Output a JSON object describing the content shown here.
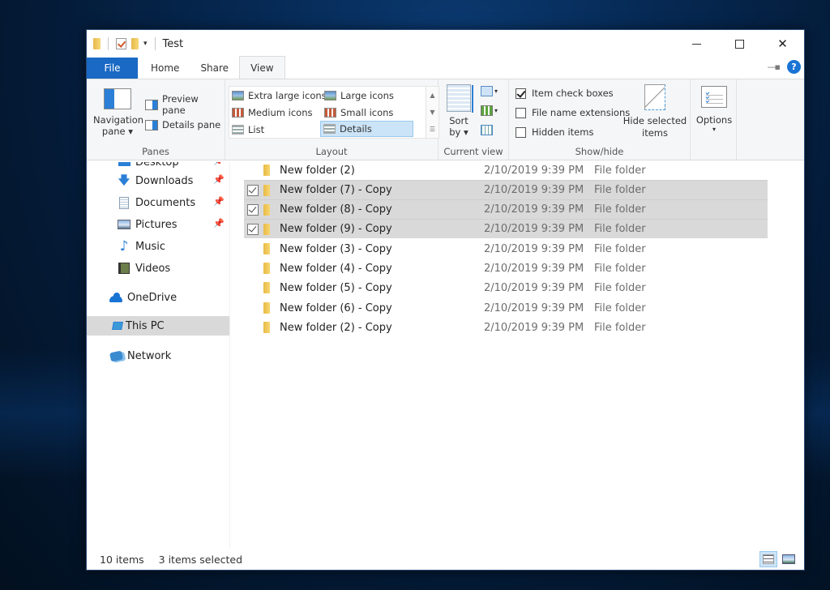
{
  "window": {
    "title": "Test",
    "controls": {
      "minimize": "minimize",
      "maximize": "maximize",
      "close": "✕"
    }
  },
  "ribbon_tabs": [
    {
      "label": "File",
      "state": "file"
    },
    {
      "label": "Home",
      "state": "normal"
    },
    {
      "label": "Share",
      "state": "normal"
    },
    {
      "label": "View",
      "state": "active"
    }
  ],
  "ribbon": {
    "panes": {
      "label": "Panes",
      "navigation_pane": [
        "Navigation",
        "pane ▾"
      ],
      "preview_pane": "Preview pane",
      "details_pane": "Details pane"
    },
    "layout": {
      "label": "Layout",
      "items": [
        {
          "label": "Extra large icons",
          "selected": false
        },
        {
          "label": "Large icons",
          "selected": false
        },
        {
          "label": "Medium icons",
          "selected": false
        },
        {
          "label": "Small icons",
          "selected": false
        },
        {
          "label": "List",
          "selected": false
        },
        {
          "label": "Details",
          "selected": true
        }
      ]
    },
    "current_view": {
      "label": "Current view",
      "sort_by": [
        "Sort",
        "by ▾"
      ]
    },
    "show_hide": {
      "label": "Show/hide",
      "checkboxes": [
        {
          "label": "Item check boxes",
          "checked": true
        },
        {
          "label": "File name extensions",
          "checked": false
        },
        {
          "label": "Hidden items",
          "checked": false
        }
      ],
      "hide_selected": [
        "Hide selected",
        "items"
      ]
    },
    "options": {
      "label": "Options",
      "caret": "▾"
    }
  },
  "nav_pane": {
    "items": [
      {
        "label": "Desktop",
        "icon": "desktop-icon",
        "pinned": true,
        "selected": false
      },
      {
        "label": "Downloads",
        "icon": "download-icon",
        "pinned": true,
        "selected": false
      },
      {
        "label": "Documents",
        "icon": "documents-icon",
        "pinned": true,
        "selected": false
      },
      {
        "label": "Pictures",
        "icon": "pictures-icon",
        "pinned": true,
        "selected": false
      },
      {
        "label": "Music",
        "icon": "music-icon",
        "pinned": false,
        "selected": false
      },
      {
        "label": "Videos",
        "icon": "videos-icon",
        "pinned": false,
        "selected": false
      },
      {
        "label": "OneDrive",
        "icon": "onedrive-icon",
        "pinned": false,
        "selected": false
      },
      {
        "label": "This PC",
        "icon": "this-pc-icon",
        "pinned": false,
        "selected": true
      },
      {
        "label": "Network",
        "icon": "network-icon",
        "pinned": false,
        "selected": false
      }
    ]
  },
  "files": [
    {
      "name": "New folder (2)",
      "date": "2/10/2019 9:39 PM",
      "type": "File folder",
      "selected": false
    },
    {
      "name": "New folder (7) - Copy",
      "date": "2/10/2019 9:39 PM",
      "type": "File folder",
      "selected": true
    },
    {
      "name": "New folder (8) - Copy",
      "date": "2/10/2019 9:39 PM",
      "type": "File folder",
      "selected": true
    },
    {
      "name": "New folder (9) - Copy",
      "date": "2/10/2019 9:39 PM",
      "type": "File folder",
      "selected": true
    },
    {
      "name": "New folder (3) - Copy",
      "date": "2/10/2019 9:39 PM",
      "type": "File folder",
      "selected": false
    },
    {
      "name": "New folder (4) - Copy",
      "date": "2/10/2019 9:39 PM",
      "type": "File folder",
      "selected": false
    },
    {
      "name": "New folder (5) - Copy",
      "date": "2/10/2019 9:39 PM",
      "type": "File folder",
      "selected": false
    },
    {
      "name": "New folder (6) - Copy",
      "date": "2/10/2019 9:39 PM",
      "type": "File folder",
      "selected": false
    },
    {
      "name": "New folder (2) - Copy",
      "date": "2/10/2019 9:39 PM",
      "type": "File folder",
      "selected": false
    }
  ],
  "status": {
    "item_count": "10 items",
    "selected_count": "3 items selected",
    "view_details": "details-view",
    "view_large": "large-icons-view"
  },
  "colors": {
    "accent": "#1a69c4",
    "selection": "#d9d9d9",
    "layout_selected": "#cce4f7",
    "folder": "#f2c95a"
  }
}
